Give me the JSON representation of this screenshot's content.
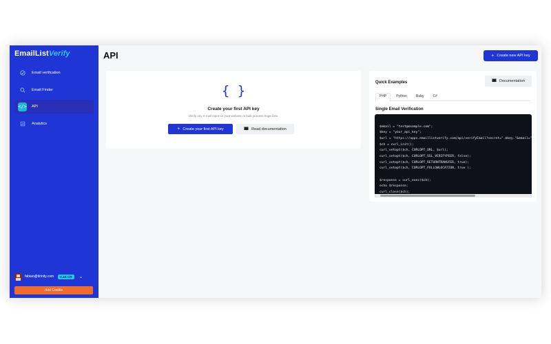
{
  "app": {
    "logo_main": "EmailList",
    "logo_accent": "Verify",
    "colors": {
      "sidebar": "#1f35d6",
      "accent": "#1bb6d9",
      "cta": "#f26b2b"
    }
  },
  "sidebar": {
    "items": [
      {
        "label": "Email verification",
        "icon": "check-circle-icon",
        "active": false
      },
      {
        "label": "Email Finder",
        "icon": "search-icon",
        "active": false
      },
      {
        "label": "API",
        "icon": "code-icon",
        "active": true
      },
      {
        "label": "Analytics",
        "icon": "chart-icon",
        "active": false
      }
    ],
    "user": {
      "email": "fabian@itrinity.com",
      "credits": "0.4K CR"
    },
    "add_credits_label": "Add Credits"
  },
  "header": {
    "title": "API",
    "create_new_label": "Create new API key"
  },
  "empty_state": {
    "title": "Create your first API key",
    "subtitle": "Verify any e-mail input on your website or bulk process huge lists.",
    "create_label": "Create your first API key",
    "docs_label": "Read documentation"
  },
  "quick_examples": {
    "title": "Quick Examples",
    "documentation_label": "Documentation",
    "tabs": [
      "PHP",
      "Python",
      "Ruby",
      "C#"
    ],
    "active_tab": "PHP",
    "section_title": "Single Email Verification",
    "code_lines": [
      "$email = \"test@example.com\";",
      "$key = \"your_api_key\";",
      "$url = \"https://apps.emaillistverify.com/api/verifyEmail?secret=\".$key.\"&email=\".$email;",
      "$ch = curl_init();",
      "curl_setopt($ch, CURLOPT_URL, $url);",
      "curl_setopt($ch, CURLOPT_SSL_VERIFYPEER, false);",
      "curl_setopt($ch, CURLOPT_RETURNTRANSFER, true);",
      "curl_setopt($ch, CURLOPT_FOLLOWLOCATION, true );",
      "",
      "$response = curl_exec($ch);",
      "echo $response;",
      "curl_close($ch);"
    ]
  }
}
